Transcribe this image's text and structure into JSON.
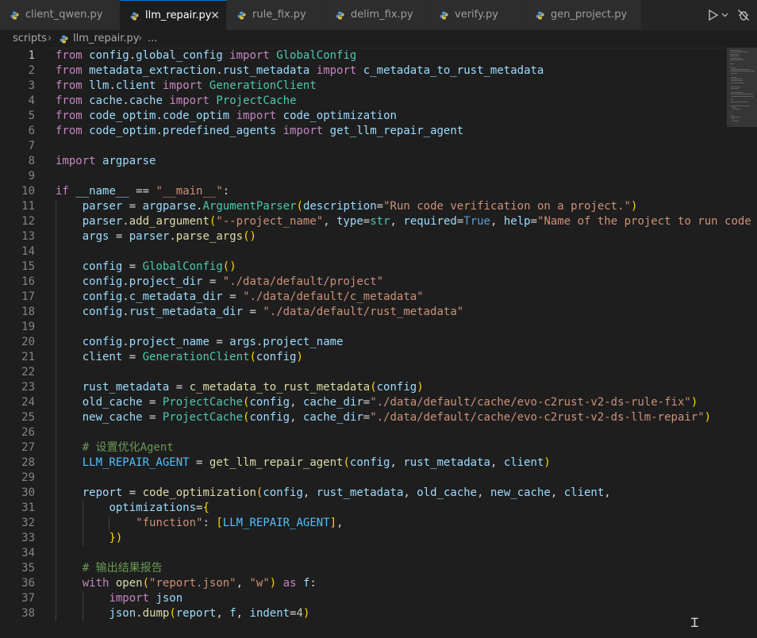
{
  "tabs": [
    {
      "label": "client_qwen.py",
      "active": false
    },
    {
      "label": "llm_repair.py",
      "active": true
    },
    {
      "label": "rule_fix.py",
      "active": false
    },
    {
      "label": "delim_fix.py",
      "active": false
    },
    {
      "label": "verify.py",
      "active": false
    },
    {
      "label": "gen_project.py",
      "active": false
    }
  ],
  "breadcrumb": {
    "folder": "scripts",
    "file": "llm_repair.py",
    "symbol": "..."
  },
  "editor": {
    "current_line": 1,
    "line_numbers": [
      "1",
      "2",
      "3",
      "4",
      "5",
      "6",
      "7",
      "8",
      "9",
      "10",
      "11",
      "12",
      "13",
      "14",
      "15",
      "16",
      "17",
      "18",
      "19",
      "20",
      "21",
      "22",
      "23",
      "24",
      "25",
      "26",
      "27",
      "28",
      "29",
      "30",
      "31",
      "32",
      "33",
      "34",
      "35",
      "36",
      "37",
      "38"
    ]
  },
  "code_lines": [
    "from config.global_config import GlobalConfig",
    "from metadata_extraction.rust_metadata import c_metadata_to_rust_metadata",
    "from llm.client import GenerationClient",
    "from cache.cache import ProjectCache",
    "from code_optim.code_optim import code_optimization",
    "from code_optim.predefined_agents import get_llm_repair_agent",
    "",
    "import argparse",
    "",
    "if __name__ == \"__main__\":",
    "    parser = argparse.ArgumentParser(description=\"Run code verification on a project.\")",
    "    parser.add_argument(\"--project_name\", type=str, required=True, help=\"Name of the project to run code",
    "    args = parser.parse_args()",
    "",
    "    config = GlobalConfig()",
    "    config.project_dir = \"./data/default/project\"",
    "    config.c_metadata_dir = \"./data/default/c_metadata\"",
    "    config.rust_metadata_dir = \"./data/default/rust_metadata\"",
    "",
    "    config.project_name = args.project_name",
    "    client = GenerationClient(config)",
    "",
    "    rust_metadata = c_metadata_to_rust_metadata(config)",
    "    old_cache = ProjectCache(config, cache_dir=\"./data/default/cache/evo-c2rust-v2-ds-rule-fix\")",
    "    new_cache = ProjectCache(config, cache_dir=\"./data/default/cache/evo-c2rust-v2-ds-llm-repair\")",
    "",
    "    # 设置优化Agent",
    "    LLM_REPAIR_AGENT = get_llm_repair_agent(config, rust_metadata, client)",
    "",
    "    report = code_optimization(config, rust_metadata, old_cache, new_cache, client,",
    "        optimizations={",
    "            \"function\": [LLM_REPAIR_AGENT],",
    "        })",
    "",
    "    # 输出结果报告",
    "    with open(\"report.json\", \"w\") as f:",
    "        import json",
    "        json.dump(report, f, indent=4)"
  ],
  "colors": {
    "background": "#1e1e1e",
    "keyword": "#c586c0",
    "function": "#dcdcaa",
    "class": "#4ec9b0",
    "string": "#ce9178",
    "comment": "#6a9955",
    "variable": "#9cdcfe",
    "active_tab_accent": "#0078d4"
  },
  "icons": [
    "python-file-icon",
    "close-icon",
    "run-icon",
    "chevron-down-icon",
    "debug-disabled-icon",
    "chevron-right-icon",
    "text-cursor-icon"
  ]
}
